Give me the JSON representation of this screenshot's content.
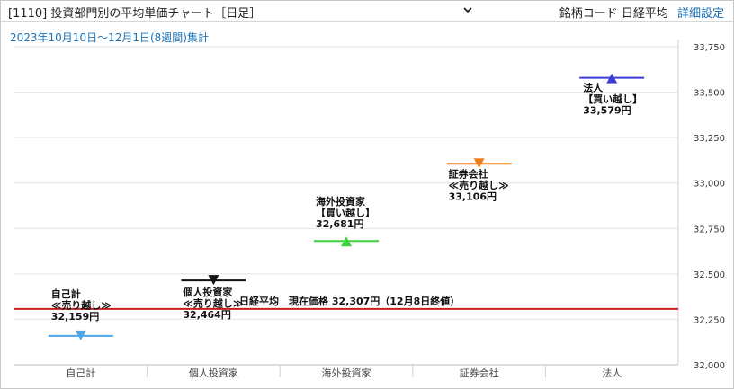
{
  "header": {
    "select_value": "[1110] 投資部門別の平均単価チャート［日足］",
    "selector_label": "銘柄コード 日経平均",
    "settings_link": "詳細設定"
  },
  "chart_data": {
    "type": "scatter",
    "period": "2023年10月10日～12月1日(8週間)集計",
    "categories": [
      "自己計",
      "個人投資家",
      "海外投資家",
      "証券会社",
      "法人"
    ],
    "points": [
      {
        "category": "自己計",
        "value": 32159,
        "lines": [
          "自己計",
          "≪売り越し≫",
          "32,159円"
        ],
        "direction": "down",
        "color": "#4ea6e6"
      },
      {
        "category": "個人投資家",
        "value": 32464,
        "lines": [
          "個人投資家",
          "≪売り越し≫",
          "32,464円"
        ],
        "direction": "down",
        "color": "#111111"
      },
      {
        "category": "海外投資家",
        "value": 32681,
        "lines": [
          "海外投資家",
          "【買い越し】",
          "32,681円"
        ],
        "direction": "up",
        "color": "#3fcf3f"
      },
      {
        "category": "証券会社",
        "value": 33106,
        "lines": [
          "証券会社",
          "≪売り越し≫",
          "33,106円"
        ],
        "direction": "down",
        "color": "#f07e1a"
      },
      {
        "category": "法人",
        "value": 33579,
        "lines": [
          "法人",
          "【買い越し】",
          "33,579円"
        ],
        "direction": "up",
        "color": "#3c3cd8"
      }
    ],
    "reference_line": {
      "value": 32307,
      "label": "日経平均　現在価格 32,307円（12月8日終値）",
      "color": "#c81e1e"
    },
    "ylim": [
      32000,
      33750
    ],
    "yticks": [
      32000,
      32250,
      32500,
      32750,
      33000,
      33250,
      33500,
      33750
    ],
    "ytick_labels": [
      "32,000",
      "32,250",
      "32,500",
      "32,750",
      "33,000",
      "33,250",
      "33,500",
      "33,750"
    ],
    "grid": true,
    "y_axis_side": "right"
  }
}
